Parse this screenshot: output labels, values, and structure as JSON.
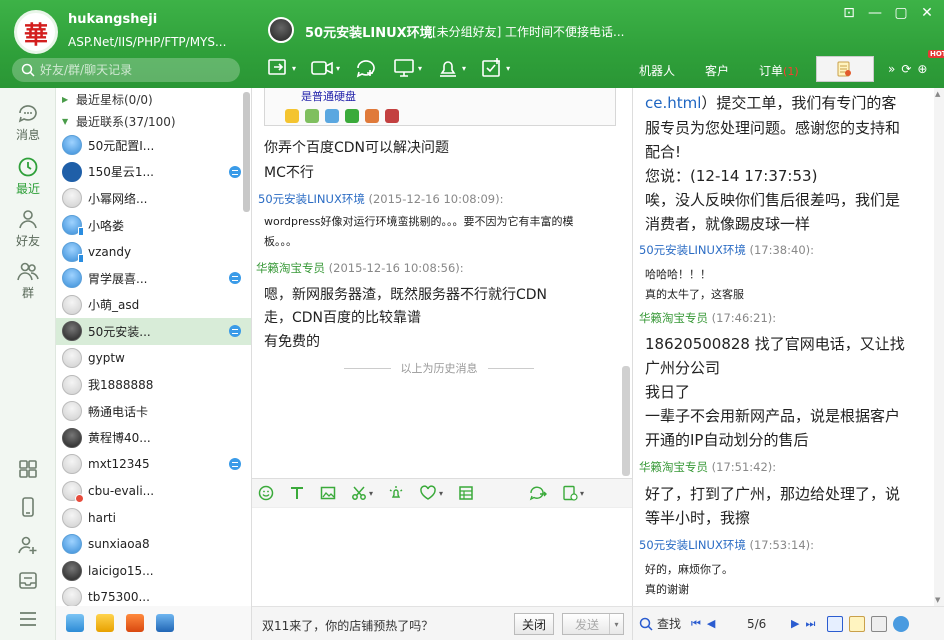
{
  "user": {
    "name": "hukangsheji",
    "signature": "ASP.Net/IIS/PHP/FTP/MYS...",
    "logo_char": "華"
  },
  "search": {
    "placeholder": "好友/群/聊天记录"
  },
  "chat_header": {
    "title": "50元安装LINUX环境",
    "group": "[未分组好友]",
    "status": "工作时间不便接电话..."
  },
  "right_tabs": {
    "robot": "机器人",
    "customer": "客户",
    "order": "订单",
    "order_badge": "(1)",
    "hot": "HOT"
  },
  "nav": {
    "messages": "消息",
    "recent": "最近",
    "friends": "好友",
    "groups": "群"
  },
  "contacts": {
    "group_star": "最近星标(0/0)",
    "group_recent": "最近联系(37/100)",
    "items": [
      {
        "name": "50元配置I..."
      },
      {
        "name": "150星云1..."
      },
      {
        "name": "小幂网络..."
      },
      {
        "name": "小咯娄"
      },
      {
        "name": "vzandy"
      },
      {
        "name": "胃学展喜..."
      },
      {
        "name": "小萌_asd"
      },
      {
        "name": "50元安装..."
      },
      {
        "name": "gyptw"
      },
      {
        "name": "我1888888"
      },
      {
        "name": "畅通电话卡"
      },
      {
        "name": "黄程博40..."
      },
      {
        "name": "mxt12345"
      },
      {
        "name": "cbu-evali..."
      },
      {
        "name": "harti"
      },
      {
        "name": "sunxiaoa8"
      },
      {
        "name": "laicigo15..."
      },
      {
        "name": "tb75300..."
      }
    ]
  },
  "chat": {
    "snippet_text": "是普通硬盘",
    "line1": "你弄个百度CDN可以解决问题",
    "line2": "MC不行",
    "msg1_name": "50元安装LINUX环境",
    "msg1_time": "(2015-12-16 10:08:09):",
    "msg1_line1": "wordpress好像对运行环境蛮挑剔的。。。要不因为它有丰富的模",
    "msg1_line2": "板。。。",
    "msg2_name": "华籁淘宝专员",
    "msg2_time": "(2015-12-16 10:08:56):",
    "msg2_line1": "嗯，新网服务器渣，既然服务器不行就行CDN",
    "msg2_line2": "走，CDN百度的比较靠谱",
    "msg2_line3": "有免费的",
    "history_divider": "以上为历史消息"
  },
  "footer": {
    "ad": "双11来了，你的店铺预热了吗？",
    "close": "关闭",
    "send": "发送"
  },
  "history": {
    "l1_link": "ce.html",
    "l1_rest": "）提交工单，我们有专门的客",
    "l2": "服专员为您处理问题。感谢您的支持和",
    "l3": "配合!",
    "l4": "您说：(12-14 17:37:53)",
    "l5": "唉，没人反映你们售后很差吗，我们是",
    "l6": "消费者，就像踢皮球一样",
    "m1_name": "50元安装LINUX环境",
    "m1_time": "(17:38:40):",
    "m1_l1": "哈哈哈！！！",
    "m1_l2": "真的太牛了，这客服",
    "m2_name": "华籁淘宝专员",
    "m2_time": "(17:46:21):",
    "m2_l1": "18620500828 找了官网电话，又让找",
    "m2_l2": "广州分公司",
    "m2_l3": "我日了",
    "m2_l4": "一辈子不会用新网产品，说是根据客户",
    "m2_l5": "开通的IP自动划分的售后",
    "m3_name": "华籁淘宝专员",
    "m3_time": "(17:51:42):",
    "m3_l1": "好了，打到了广州，那边给处理了，说",
    "m3_l2": "等半小时，我擦",
    "m4_name": "50元安装LINUX环境",
    "m4_time": "(17:53:14):",
    "m4_l1": "好的，麻烦你了。",
    "m4_l2": "真的谢谢",
    "search_label": "查找",
    "page": "5/6"
  }
}
